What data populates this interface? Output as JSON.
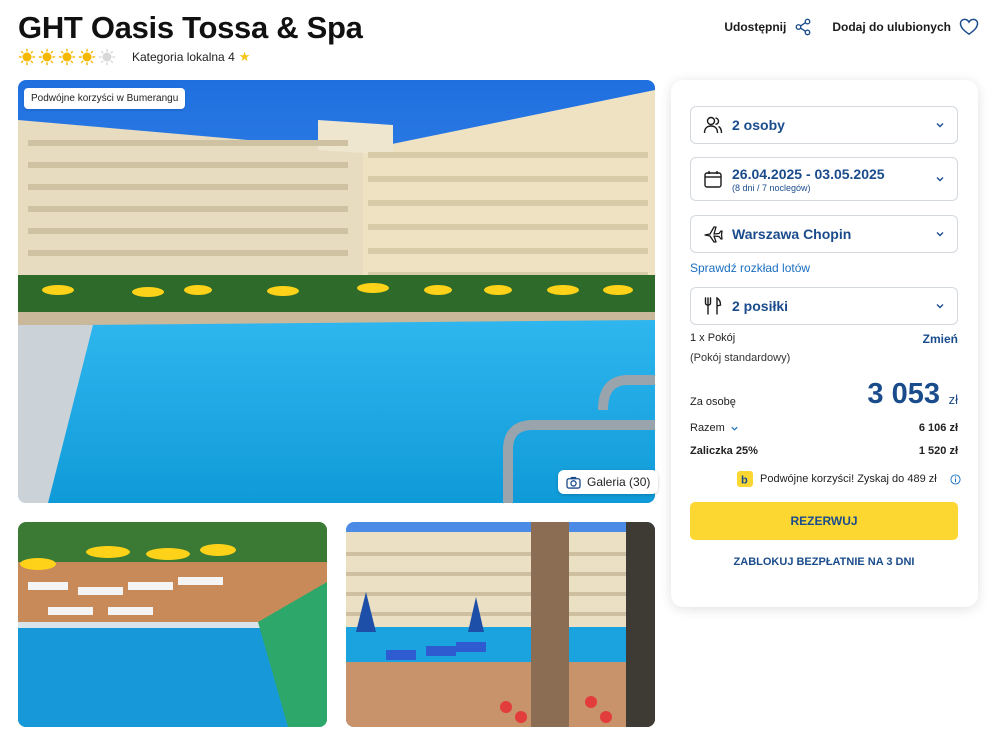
{
  "hotel": {
    "name": "GHT Oasis Tossa & Spa",
    "suns": 4,
    "suns_total": 5,
    "category_label": "Kategoria lokalna 4",
    "category_star": "★"
  },
  "actions": {
    "share_label": "Udostępnij",
    "favorite_label": "Dodaj do ulubionych"
  },
  "gallery": {
    "promo_badge": "Podwójne korzyści w Bumerangu",
    "gallery_label": "Galeria (30)"
  },
  "booking": {
    "persons": "2 osoby",
    "dates": "26.04.2025 - 03.05.2025",
    "dates_sub": "(8 dni / 7 noclegów)",
    "airport": "Warszawa Chopin",
    "flight_link": "Sprawdź rozkład lotów",
    "meals": "2 posiłki",
    "room_count": "1 x Pokój",
    "room_type": "(Pokój standardowy)",
    "change_label": "Zmień",
    "per_person_label": "Za osobę",
    "price": "3 053",
    "currency": "zł",
    "total_label": "Razem",
    "total_value": "6 106 zł",
    "deposit_label": "Zaliczka 25%",
    "deposit_value": "1 520 zł",
    "bonus_text": "Podwójne korzyści! Zyskaj do 489 zł",
    "reserve_label": "REZERWUJ",
    "block_label": "ZABLOKUJ BEZPŁATNIE NA 3 DNI"
  },
  "colors": {
    "primary_blue": "#1a4c8c",
    "link_blue": "#1a6fc2",
    "accent_yellow": "#fcd732",
    "sun_yellow": "#f5b800"
  },
  "icons": [
    "sun-icon",
    "share-icon",
    "heart-icon",
    "camera-icon",
    "person-icon",
    "calendar-icon",
    "plane-icon",
    "cutlery-icon",
    "chevron-down-icon",
    "bonus-logo-icon",
    "info-icon"
  ]
}
